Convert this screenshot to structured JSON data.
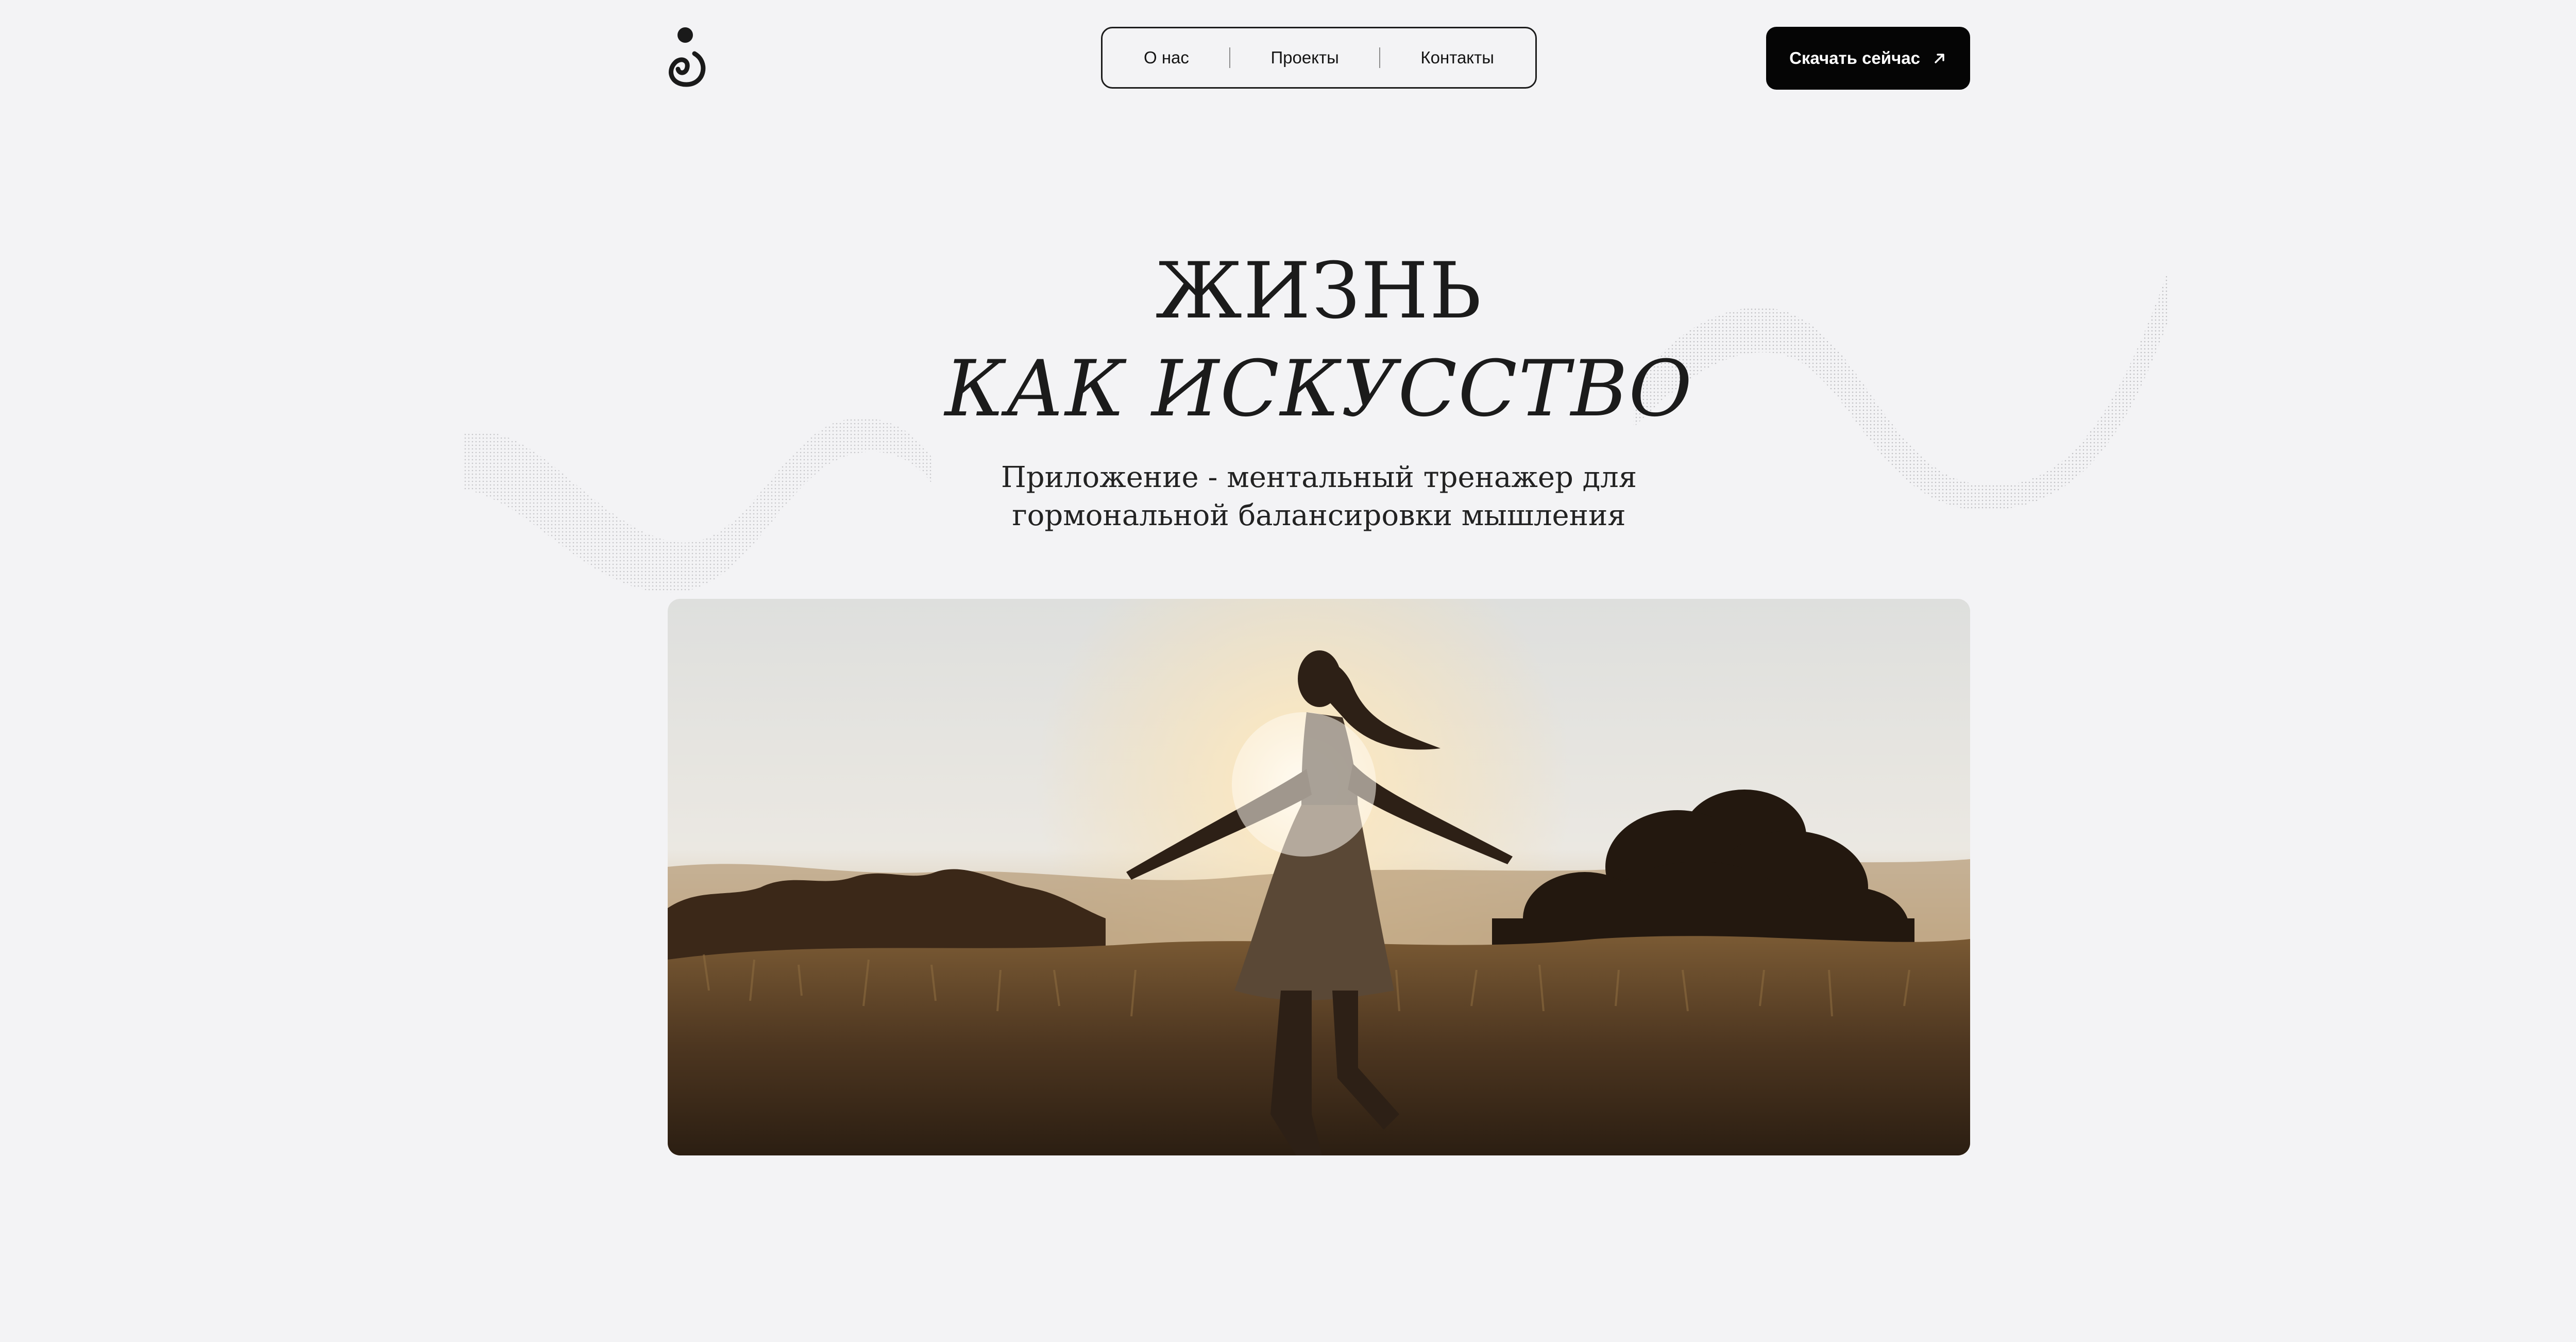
{
  "header": {
    "logo_name": "logo-icon",
    "nav": [
      {
        "label": "О нас"
      },
      {
        "label": "Проекты"
      },
      {
        "label": "Контакты"
      }
    ],
    "cta_label": "Скачать сейчас",
    "cta_icon": "arrow-up-right-icon"
  },
  "hero": {
    "title_line1": "ЖИЗНЬ",
    "title_line2": "КАК ИСКУССТВО",
    "subtitle_line1": "Приложение - ментальный тренажер для",
    "subtitle_line2": "гормональной балансировки мышления"
  },
  "colors": {
    "background": "#f3f3f5",
    "text": "#1b1b1b",
    "button": "#050505",
    "button_text": "#ffffff"
  }
}
